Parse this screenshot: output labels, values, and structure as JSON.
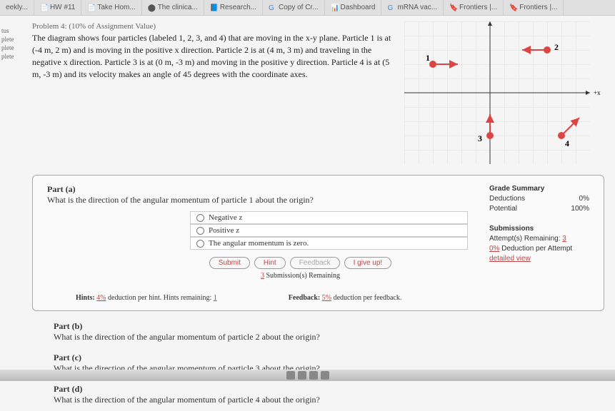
{
  "tabs": [
    "eekly...",
    "HW #11",
    "Take Hom...",
    "The clinica...",
    "Research...",
    "Copy of Cr...",
    "Dashboard",
    "mRNA vac...",
    "Frontiers |...",
    "Frontiers |..."
  ],
  "sidebar": [
    "tus",
    "plete",
    "plete",
    "plete"
  ],
  "problem": {
    "title": "Problem 4: (10% of Assignment Value)",
    "body": "The diagram shows four particles (labeled 1, 2, 3, and 4) that are moving in the x-y plane. Particle 1 is at (-4 m, 2 m) and is moving in the positive x direction. Particle 2 is at (4 m, 3 m) and traveling in the negative x direction. Particle 3 is at (0 m, -3 m) and moving in the positive y direction. Particle 4 is at (5 m, -3 m) and its velocity makes an angle of 45 degrees with the coordinate axes."
  },
  "diagram": {
    "axis_x": "+x",
    "labels": {
      "p1": "1",
      "p2": "2",
      "p3": "3",
      "p4": "4"
    }
  },
  "partA": {
    "label": "Part (a)",
    "question": "What is the direction of the angular momentum of particle 1 about the origin?",
    "options": [
      "Negative z",
      "Positive z",
      "The angular momentum is zero."
    ],
    "buttons": {
      "submit": "Submit",
      "hint": "Hint",
      "feedback": "Feedback",
      "giveup": "I give up!"
    },
    "subs_remaining_n": "3",
    "subs_remaining_t": " Submission(s) Remaining",
    "hints_pre": "Hints: ",
    "hints_pct": "4%",
    "hints_mid": " deduction per hint. Hints remaining: ",
    "hints_n": "1",
    "feedback_pre": "Feedback: ",
    "feedback_pct": "5%",
    "feedback_post": " deduction per feedback."
  },
  "grade": {
    "title": "Grade Summary",
    "ded_l": "Deductions",
    "ded_v": "0%",
    "pot_l": "Potential",
    "pot_v": "100%",
    "sub_title": "Submissions",
    "att_l": "Attempt(s) Remaining: ",
    "att_v": "3",
    "att_ded": "0%",
    "att_ded_t": " Deduction per Attempt",
    "detailed": "detailed view"
  },
  "partB": {
    "label": "Part (b)",
    "q": "What is the direction of the angular momentum of particle 2 about the origin?"
  },
  "partC": {
    "label": "Part (c)",
    "q": "What is the direction of the angular momentum of particle 3 about the origin?"
  },
  "partD": {
    "label": "Part (d)",
    "q": "What is the direction of the angular momentum of particle 4 about the origin?"
  }
}
